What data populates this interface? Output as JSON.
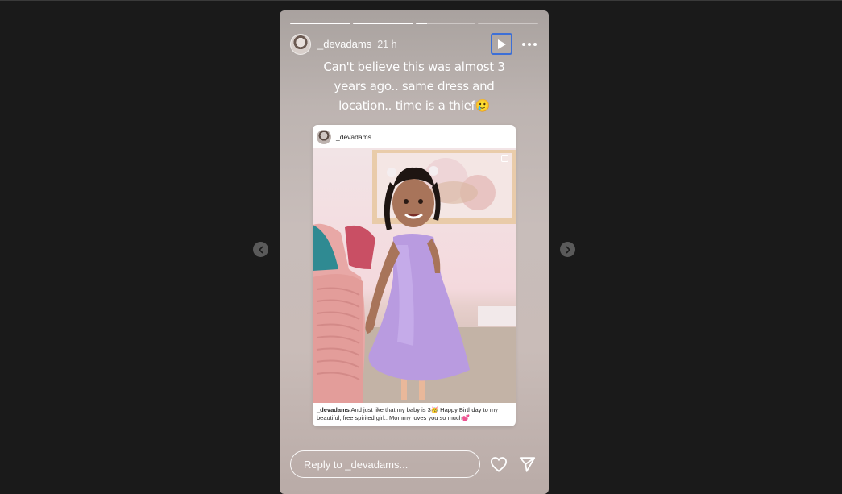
{
  "story": {
    "username": "_devadams",
    "time_ago": "21 h",
    "progress": [
      1.0,
      1.0,
      0.2,
      0.0
    ],
    "caption": "Can't believe this was almost 3 years ago.. same dress and location.. time is a thief🥲",
    "play_icon": "play-icon",
    "more_icon": "more-options-icon"
  },
  "shared_post": {
    "username": "_devadams",
    "caption_username": "_devadams",
    "caption_text": "And just like that my baby is 3🥳 Happy Birthday to my beautiful, free spirited girl.. Mommy loves you so much💕",
    "multi_icon": "carousel-icon"
  },
  "footer": {
    "reply_placeholder": "Reply to _devadams...",
    "like_icon": "heart-icon",
    "share_icon": "send-icon"
  },
  "navigation": {
    "prev_icon": "chevron-left-icon",
    "next_icon": "chevron-right-icon"
  },
  "colors": {
    "page_background": "#1a1a1a",
    "focus_outline": "#3d6fd6",
    "dress": "#b99be0"
  }
}
